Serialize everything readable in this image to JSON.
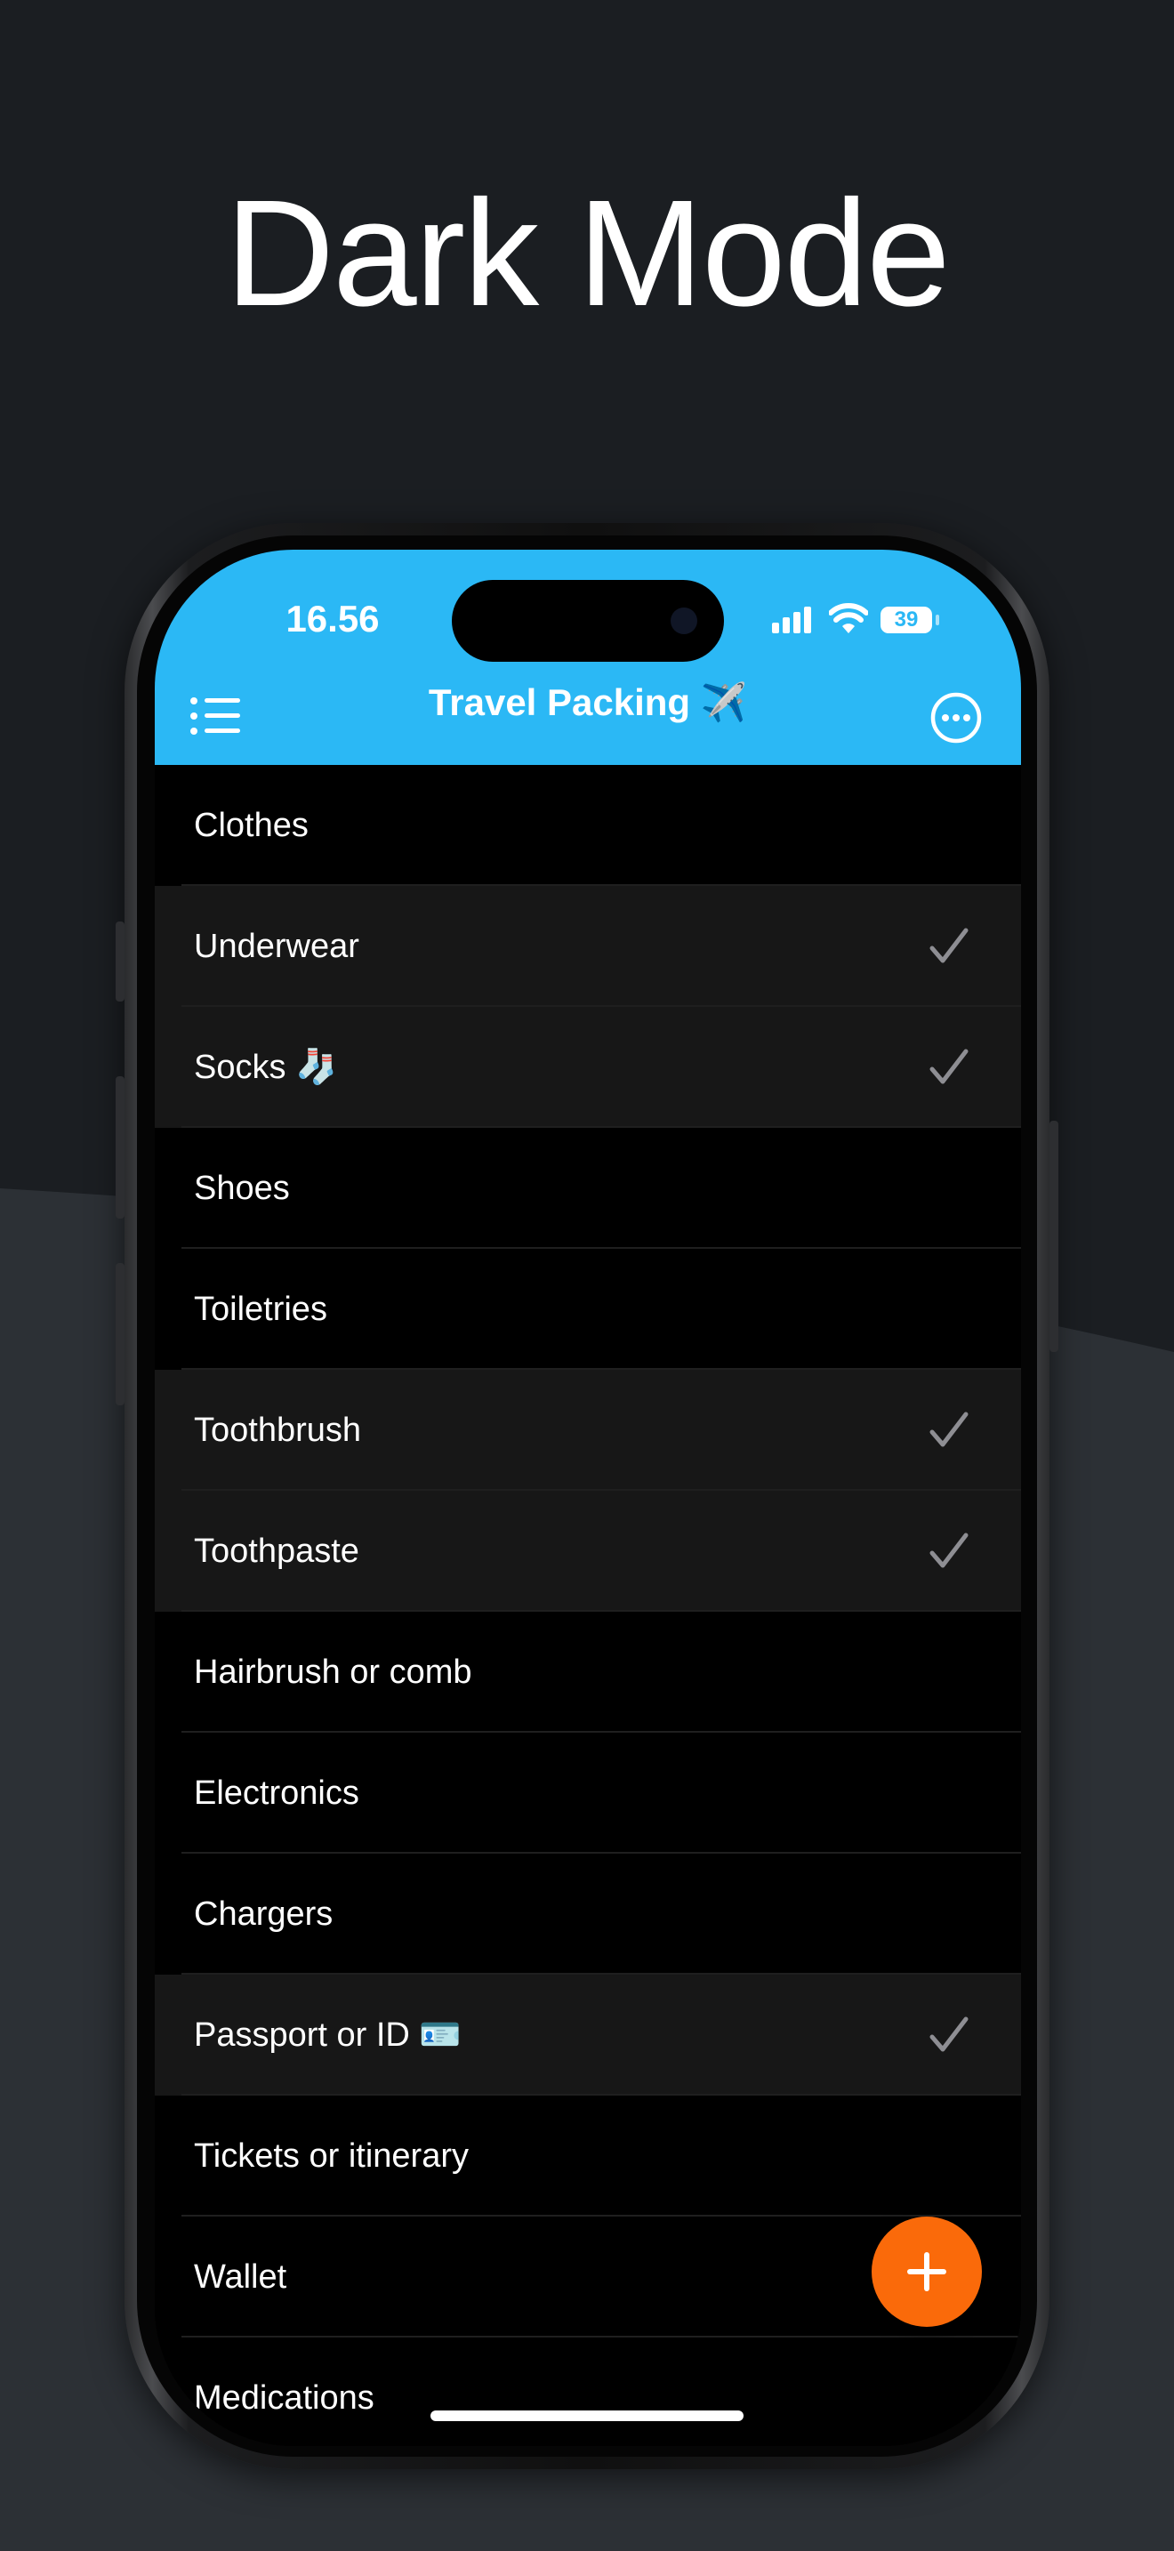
{
  "headline": "Dark Mode",
  "status_bar": {
    "time": "16.56",
    "battery": "39"
  },
  "nav": {
    "title": "Travel Packing ✈️",
    "menu_icon": "list-icon",
    "more_icon": "ellipsis-circle-icon"
  },
  "items": [
    {
      "label": "Clothes",
      "checked": false
    },
    {
      "label": "Underwear",
      "checked": true
    },
    {
      "label": "Socks 🧦",
      "checked": true
    },
    {
      "label": "Shoes",
      "checked": false
    },
    {
      "label": "Toiletries",
      "checked": false
    },
    {
      "label": "Toothbrush",
      "checked": true
    },
    {
      "label": "Toothpaste",
      "checked": true
    },
    {
      "label": "Hairbrush or comb",
      "checked": false
    },
    {
      "label": "Electronics",
      "checked": false
    },
    {
      "label": "Chargers",
      "checked": false
    },
    {
      "label": "Passport or ID 🪪",
      "checked": true
    },
    {
      "label": "Tickets or itinerary",
      "checked": false
    },
    {
      "label": "Wallet",
      "checked": false
    },
    {
      "label": "Medications",
      "checked": false
    }
  ],
  "fab_icon": "plus-icon",
  "colors": {
    "header": "#2bb8f5",
    "fab": "#fa6a0a",
    "background": "#1b1e22",
    "row_checked": "#171717"
  }
}
